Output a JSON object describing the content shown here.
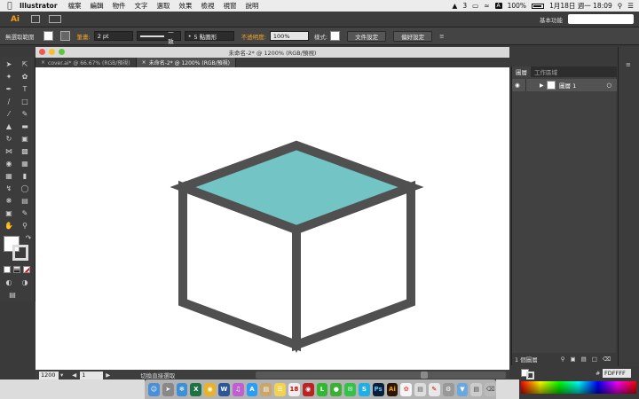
{
  "menubar": {
    "app": "Illustrator",
    "items": [
      "檔案",
      "編輯",
      "物件",
      "文字",
      "選取",
      "效果",
      "檢視",
      "視窗",
      "說明"
    ],
    "status": {
      "adobe_count": "3",
      "battery": "100%",
      "input_method": "A",
      "datetime": "1月18日 週一 18:09"
    }
  },
  "appbar": {
    "logo": "Ai",
    "workspace": "基本功能"
  },
  "control": {
    "no_selection": "無選取範圍",
    "stroke_label": "筆畫:",
    "stroke_value": "2 pt",
    "line_style": "一致",
    "brush": "5 點圓形",
    "opacity_label": "不透明度:",
    "opacity_value": "100%",
    "style_label": "樣式:",
    "doc_setup": "文件設定",
    "prefs": "偏好設定"
  },
  "document": {
    "title": "未命名-2* @ 1200% (RGB/預視)",
    "tabs": [
      {
        "label": "cover.ai* @ 66.67% (RGB/預視)",
        "active": false
      },
      {
        "label": "未命名-2* @ 1200% (RGB/預視)",
        "active": true
      }
    ],
    "status": {
      "zoom": "1200",
      "page": "1",
      "tool": "切換直接選取"
    }
  },
  "layers": {
    "tab_layers": "圖層",
    "tab_artboards": "工作區域",
    "layer_name": "圖層 1",
    "count": "1 個圖層"
  },
  "color": {
    "hex_prefix": "#",
    "hex": "FDFFFF"
  },
  "artwork": {
    "stroke_color": "#505050",
    "top_fill": "#73c4c4",
    "side_fill": "#ffffff"
  },
  "colors": {
    "menubar": "#ececec",
    "panel": "#3c3c3c",
    "accent_orange": "#f5a623"
  }
}
